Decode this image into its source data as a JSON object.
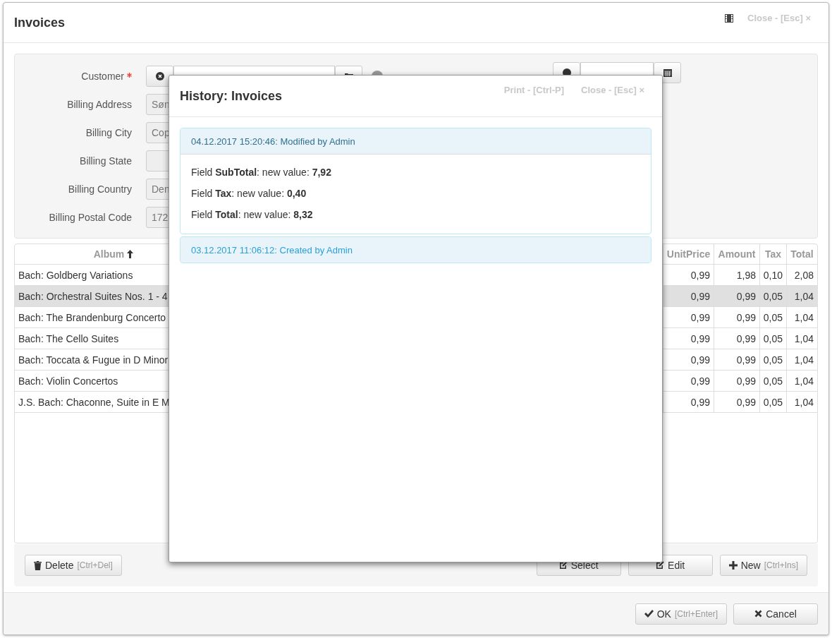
{
  "dialog": {
    "title": "Invoices",
    "close": "Close - [Esc] ×"
  },
  "form": {
    "fields": [
      {
        "label": "Customer",
        "required": true,
        "kind": "lookup"
      },
      {
        "label": "Billing Address",
        "required": false,
        "kind": "text",
        "value": "Søn"
      },
      {
        "label": "Billing City",
        "required": false,
        "kind": "text",
        "value": "Cop"
      },
      {
        "label": "Billing State",
        "required": false,
        "kind": "text"
      },
      {
        "label": "Billing Country",
        "required": false,
        "kind": "text",
        "value": "Den"
      },
      {
        "label": "Billing Postal Code",
        "required": false,
        "kind": "text",
        "value": "172"
      }
    ]
  },
  "table": {
    "columns": [
      {
        "label": "Album",
        "sorted": true
      },
      {
        "label": "UnitPrice",
        "sorted": false
      },
      {
        "label": "Amount",
        "sorted": false
      },
      {
        "label": "Tax",
        "sorted": false
      },
      {
        "label": "Total",
        "sorted": false
      }
    ],
    "rows": [
      {
        "album": "Bach: Goldberg Variations",
        "unit_price": "0,99",
        "amount": "1,98",
        "tax": "0,10",
        "total": "2,08",
        "selected": false
      },
      {
        "album": "Bach: Orchestral Suites Nos. 1 - 4",
        "unit_price": "0,99",
        "amount": "0,99",
        "tax": "0,05",
        "total": "1,04",
        "selected": true
      },
      {
        "album": "Bach: The Brandenburg Concerto",
        "unit_price": "0,99",
        "amount": "0,99",
        "tax": "0,05",
        "total": "1,04",
        "selected": false
      },
      {
        "album": "Bach: The Cello Suites",
        "unit_price": "0,99",
        "amount": "0,99",
        "tax": "0,05",
        "total": "1,04",
        "selected": false
      },
      {
        "album": "Bach: Toccata & Fugue in D Minor",
        "unit_price": "0,99",
        "amount": "0,99",
        "tax": "0,05",
        "total": "1,04",
        "selected": false
      },
      {
        "album": "Bach: Violin Concertos",
        "unit_price": "0,99",
        "amount": "0,99",
        "tax": "0,05",
        "total": "1,04",
        "selected": false
      },
      {
        "album": "J.S. Bach: Chaconne, Suite in E M",
        "unit_price": "0,99",
        "amount": "0,99",
        "tax": "0,05",
        "total": "1,04",
        "selected": false
      }
    ]
  },
  "toolbar": {
    "delete": {
      "label": "Delete",
      "shortcut": "[Ctrl+Del]"
    },
    "buttons": [
      {
        "kind": "select",
        "label": "Select"
      },
      {
        "kind": "edit",
        "label": "Edit"
      },
      {
        "kind": "new",
        "label": "New",
        "shortcut": "[Ctrl+Ins]"
      }
    ]
  },
  "footer": {
    "ok": {
      "label": "OK",
      "shortcut": "[Ctrl+Enter]"
    },
    "cancel": {
      "label": "Cancel"
    }
  },
  "history": {
    "title": "History: Invoices",
    "print": "Print - [Ctrl-P]",
    "close": "Close - [Esc] ×",
    "entries": [
      {
        "header": "04.12.2017 15:20:46: Modified by Admin",
        "expanded": true,
        "changes": [
          "Field **SubTotal**: new value: **7,92**",
          "Field **Tax**: new value: **0,40**",
          "Field **Total**: new value: **8,32**"
        ]
      },
      {
        "header": "03.12.2017 11:06:12: Created by Admin",
        "expanded": false
      }
    ]
  }
}
